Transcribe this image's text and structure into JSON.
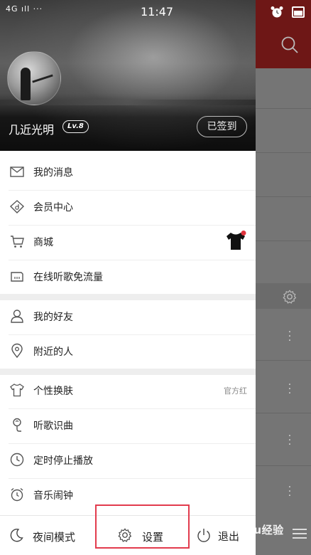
{
  "status_bar": {
    "signal": "4G ıll ···",
    "time": "11:47"
  },
  "profile": {
    "username": "几近光明",
    "level": "Lv.8",
    "sign_in_label": "已签到"
  },
  "menu": {
    "section1": [
      {
        "label": "我的消息",
        "icon": "mail-icon"
      },
      {
        "label": "会员中心",
        "icon": "diamond-icon"
      },
      {
        "label": "商城",
        "icon": "cart-icon"
      },
      {
        "label": "在线听歌免流量",
        "icon": "sim-card-icon"
      }
    ],
    "section2": [
      {
        "label": "我的好友",
        "icon": "user-icon"
      },
      {
        "label": "附近的人",
        "icon": "location-pin-icon"
      }
    ],
    "section3": [
      {
        "label": "个性换肤",
        "icon": "tshirt-icon",
        "extra": "官方红"
      },
      {
        "label": "听歌识曲",
        "icon": "microphone-icon"
      },
      {
        "label": "定时停止播放",
        "icon": "clock-icon"
      },
      {
        "label": "音乐闹钟",
        "icon": "alarm-clock-icon"
      }
    ]
  },
  "bottom_bar": {
    "night_mode_label": "夜间模式",
    "settings_label": "设置",
    "exit_label": "退出"
  },
  "watermark": "Baidu经验",
  "colors": {
    "highlight": "#e23b4d",
    "red_bar": "#6e1716",
    "notification_dot": "#e0333c"
  }
}
